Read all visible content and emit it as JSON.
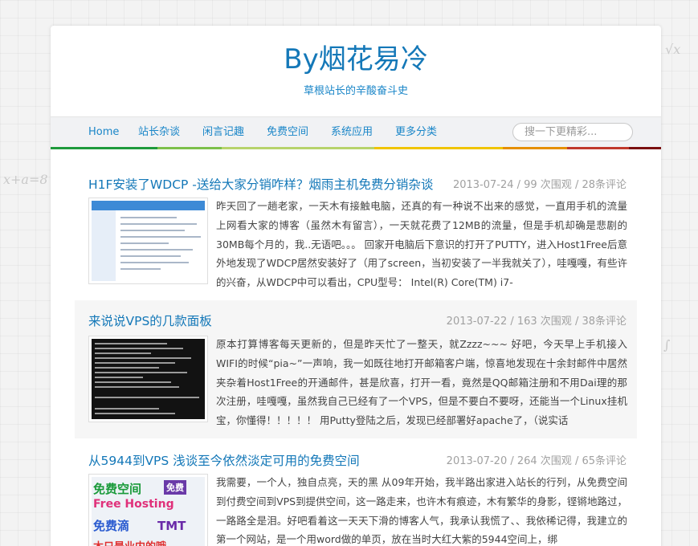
{
  "header": {
    "title": "By烟花易冷",
    "subtitle": "草根站长的辛酸奋斗史"
  },
  "nav": {
    "items": [
      "Home",
      "站长杂谈",
      "闲言记趣",
      "免费空间",
      "系统应用",
      "更多分类"
    ]
  },
  "search": {
    "placeholder": "搜一下更精彩..."
  },
  "accent_colors": [
    "#1e9a3c",
    "#7cc04a",
    "#b7d36b",
    "#f0c400",
    "#e58f00",
    "#c0392b",
    "#7a1010"
  ],
  "posts": [
    {
      "title": "H1F安装了WDCP -送给大家分销咋样？烟雨主机免费分销杂谈",
      "meta": "2013-07-24 / 99 次围观 / 28条评论",
      "excerpt": "昨天回了一趟老家，一天木有接触电脑，还真的有一种说不出来的感觉，一直用手机的流量上网看大家的博客（虽然木有留言），一天就花费了12MB的流量，但是手机却确是悲剧的30MB每个月的，我..无语吧。。。 回家开电脑后下意识的打开了PUTTY，进入Host1Free后意外地发现了WDCP居然安装好了（用了screen，当初安装了一半我就关了），哇嘎嘎，有些许的兴奋，从WDCP中可以看出，CPU型号： Intel(R) Core(TM) i7-",
      "thumb": "wdcp-panel-screenshot"
    },
    {
      "title": "来说说VPS的几款面板",
      "meta": "2013-07-22 / 163 次围观 / 38条评论",
      "excerpt": "原本打算博客每天更新的，但是昨天忙了一整天，就Zzzz~~~ 好吧，今天早上手机接入WIFI的时候“pia~”一声响，我一如既往地打开邮箱客户端，惊喜地发现在十余封邮件中居然夹杂着Host1Free的开通邮件，甚是欣喜，打开一看，竟然是QQ邮箱注册和不用Dai理的那次注册，哇嘎嘎，虽然我自己已经有了一个VPS，但是不要白不要呀，还能当一个Linux挂机宝，你懂得！！！！！ 用Putty登陆之后，发现已经部署好apache了，（说实话",
      "thumb": "terminal-screenshot"
    },
    {
      "title": "从5944到VPS 浅谈至今依然淡定可用的免费空间",
      "meta": "2013-07-20 / 264 次围观 / 65条评论",
      "excerpt": "我需要，一个人，独自点亮，天的黑 从09年开始，我半路出家进入站长的行列，从免费空间到付费空间到VPS到提供空间，这一路走来，也许木有痕迹，木有繁华的身影，铿锵地路过，一路路全是泪。好吧看着这一天天下滑的博客人气，我承认我慌了、、我依稀记得，我建立的第一个网站，是一个用word做的单页，放在当时大红大紫的5944空间上，绑",
      "thumb": "free-hosting-banner",
      "thumb_text": [
        "免费空间",
        "免费",
        "Free Hosting",
        "免费滴",
        "TMT",
        "木只是业内的哦"
      ]
    }
  ]
}
